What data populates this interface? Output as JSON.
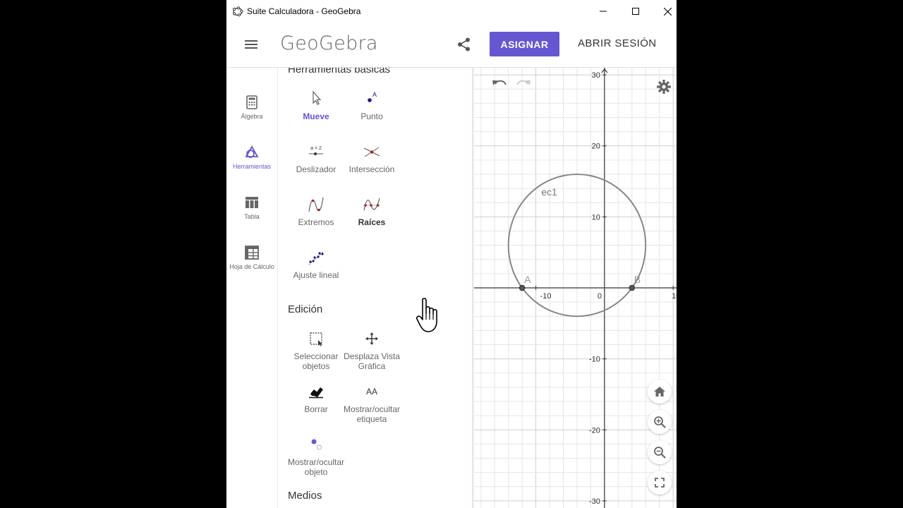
{
  "window": {
    "title": "Suite Calculadora - GeoGebra"
  },
  "header": {
    "logo": "GeoGebra",
    "assign_label": "ASIGNAR",
    "login_label": "ABRIR SESIÓN"
  },
  "rail": {
    "items": [
      {
        "label": "Álgebra",
        "icon": "calculator-icon"
      },
      {
        "label": "Herramientas",
        "icon": "tools-icon",
        "active": true
      },
      {
        "label": "Tabla",
        "icon": "table-icon"
      },
      {
        "label": "Hoja de Cálculo",
        "icon": "spreadsheet-icon"
      }
    ]
  },
  "tools": {
    "sections": [
      {
        "title": "Herramientas básicas",
        "items": [
          {
            "label": "Mueve",
            "icon": "move-icon",
            "selected": true
          },
          {
            "label": "Punto",
            "icon": "point-icon"
          },
          {
            "label": "Deslizador",
            "icon": "slider-icon",
            "icon_text": "a = 2"
          },
          {
            "label": "Intersección",
            "icon": "intersect-icon"
          },
          {
            "label": "Extremos",
            "icon": "extremum-icon"
          },
          {
            "label": "Raíces",
            "icon": "roots-icon"
          },
          {
            "label": "Ajuste lineal",
            "icon": "fit-line-icon"
          }
        ]
      },
      {
        "title": "Edición",
        "items": [
          {
            "label": "Seleccionar objetos",
            "icon": "select-icon"
          },
          {
            "label": "Desplaza Vista Gráfica",
            "icon": "move-view-icon"
          },
          {
            "label": "Borrar",
            "icon": "eraser-icon"
          },
          {
            "label": "Mostrar/ocultar etiqueta",
            "icon": "label-icon",
            "icon_text": "AA"
          },
          {
            "label": "Mostrar/ocultar objeto",
            "icon": "show-hide-icon"
          }
        ]
      },
      {
        "title": "Medios"
      }
    ]
  },
  "graphics": {
    "axes": {
      "x_range": [
        -19,
        10.5
      ],
      "y_range": [
        -31,
        31
      ],
      "x_ticks": [
        "-10",
        "0",
        "10"
      ],
      "y_ticks": [
        "30",
        "20",
        "10",
        "-10",
        "-20",
        "-30"
      ],
      "grid": true
    },
    "objects": {
      "circle": {
        "name": "ec1",
        "center": [
          -4,
          6
        ],
        "radius": 10
      },
      "points": [
        {
          "name": "A",
          "x": -12,
          "y": 0
        },
        {
          "name": "B",
          "x": 4,
          "y": 0
        }
      ]
    },
    "colors": {
      "accent": "#6557d2",
      "grid": "#e6e6e6",
      "object": "#888888"
    }
  }
}
